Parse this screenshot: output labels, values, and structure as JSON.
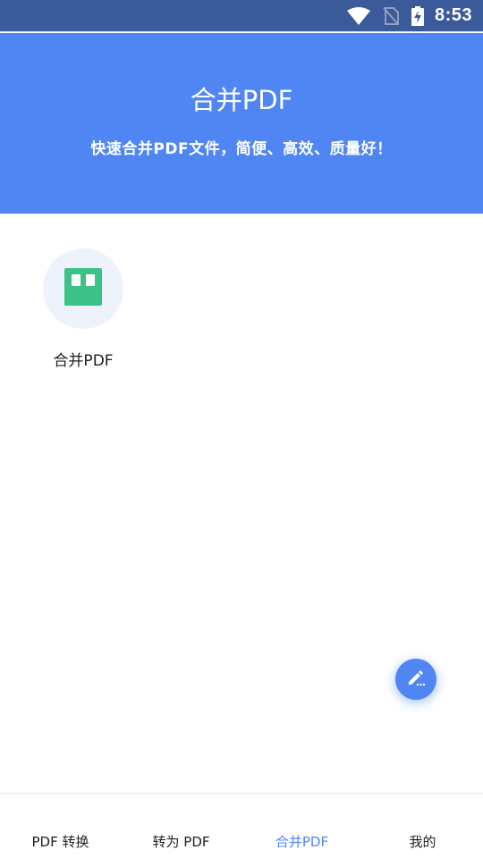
{
  "status_bar": {
    "time": "8:53",
    "icons": [
      "wifi-icon",
      "no-sim-icon",
      "battery-charging-icon"
    ]
  },
  "header": {
    "title": "合并PDF",
    "subtitle": "快速合并PDF文件，简便、高效、质量好！",
    "background_color": "#4f86f3"
  },
  "tools": [
    {
      "label": "合并PDF",
      "icon": "merge-pdf-icon",
      "icon_color": "#3cc189"
    }
  ],
  "fab": {
    "icon": "edit-pencil-icon",
    "color": "#4f86f3"
  },
  "bottom_nav": {
    "items": [
      {
        "label": "PDF 转换",
        "active": false
      },
      {
        "label": "转为 PDF",
        "active": false
      },
      {
        "label": "合并PDF",
        "active": true
      },
      {
        "label": "我的",
        "active": false
      }
    ],
    "active_color": "#4f86f3"
  }
}
